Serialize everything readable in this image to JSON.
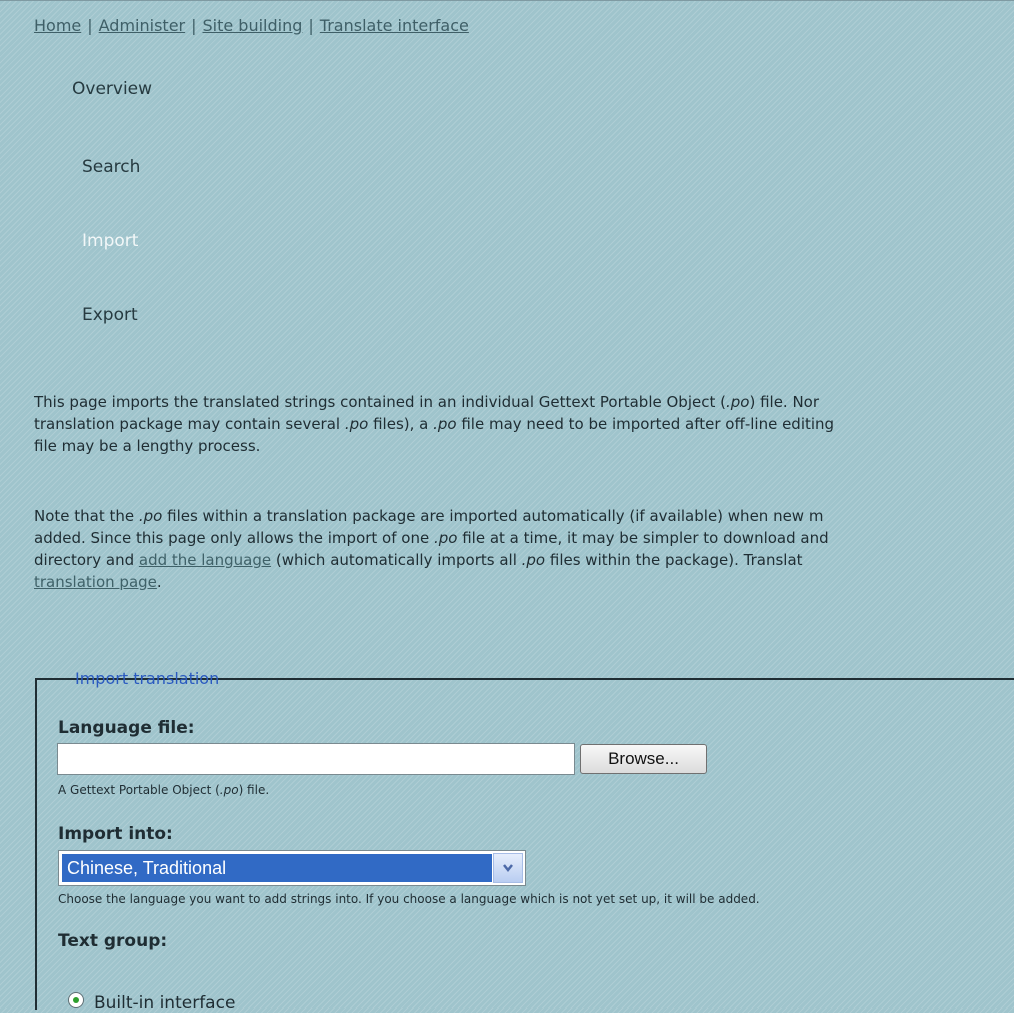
{
  "breadcrumb": {
    "items": [
      "Home",
      "Administer",
      "Site building",
      "Translate interface"
    ],
    "separator": "|"
  },
  "tabs": {
    "overview": "Overview",
    "search": "Search",
    "import": "Import",
    "export": "Export"
  },
  "intro": {
    "line1": "This page imports the translated strings contained in an individual Gettext Portable Object (",
    "po": ".po",
    "line1_end": ") file. Nor",
    "line2_a": "translation package may contain several ",
    "line2_b": " files), a ",
    "line2_c": " file may need to be imported after off-line editing",
    "line3": "file may be a lengthy process."
  },
  "note": {
    "line1_a": "Note that the ",
    "line1_b": " files within a translation package are imported automatically (if available) when new m",
    "line2_a": "added. Since this page only allows the import of one ",
    "line2_b": " file at a time, it may be simpler to download and",
    "line3_a": "directory and ",
    "add_language_link": "add the language",
    "line3_b": " (which automatically imports all ",
    "line3_c": " files within the package). Translat",
    "translation_page_link": "translation page",
    "period": "."
  },
  "form": {
    "legend": "Import translation",
    "language_file_label": "Language file:",
    "language_file_value": "",
    "browse_label": "Browse...",
    "language_file_desc_a": "A Gettext Portable Object (",
    "language_file_desc_po": ".po",
    "language_file_desc_b": ") file.",
    "import_into_label": "Import into:",
    "import_into_value": "Chinese, Traditional",
    "import_into_desc": "Choose the language you want to add strings into. If you choose a language which is not yet set up, it will be added.",
    "text_group_label": "Text group:",
    "text_group_option": "Built-in interface"
  },
  "colors": {
    "background": "#9fc4cc",
    "link": "#3f5f67",
    "legend": "#2a5ac0",
    "selected": "#316ac5"
  }
}
